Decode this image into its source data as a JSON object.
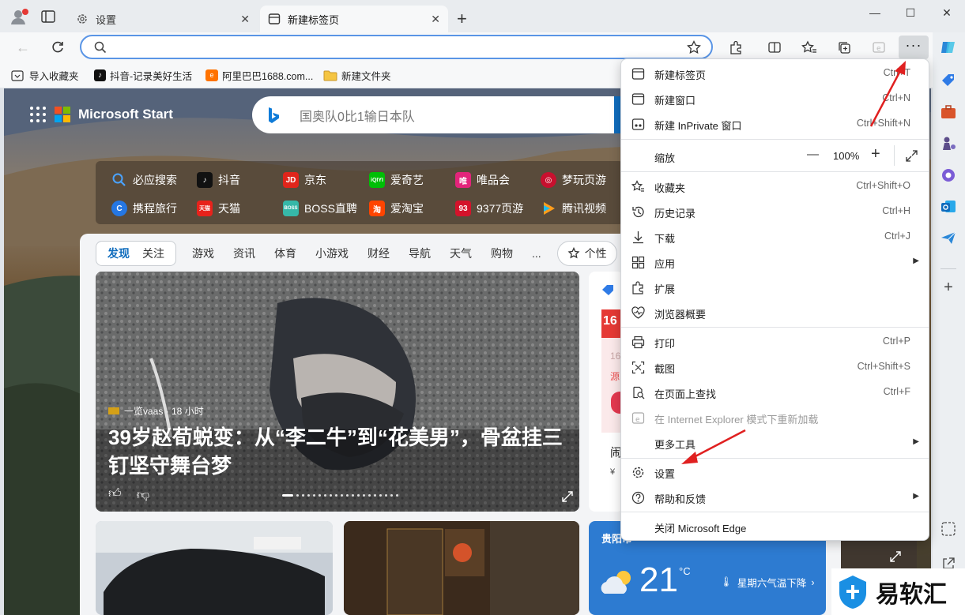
{
  "tabs": [
    {
      "label": "设置"
    },
    {
      "label": "新建标签页"
    }
  ],
  "address": {
    "value": ""
  },
  "favorites": [
    {
      "label": "导入收藏夹"
    },
    {
      "label": "抖音-记录美好生活"
    },
    {
      "label": "阿里巴巴1688.com..."
    },
    {
      "label": "新建文件夹"
    }
  ],
  "ms_start": {
    "label": "Microsoft Start"
  },
  "search": {
    "placeholder": "国奥队0比1输日本队"
  },
  "quick_links": [
    {
      "label": "必应搜索"
    },
    {
      "label": "抖音"
    },
    {
      "label": "京东"
    },
    {
      "label": "爱奇艺"
    },
    {
      "label": "唯品会"
    },
    {
      "label": "梦玩页游"
    },
    {
      "label": "携程旅行"
    },
    {
      "label": "天猫"
    },
    {
      "label": "BOSS直聘"
    },
    {
      "label": "爱淘宝"
    },
    {
      "label": "9377页游"
    },
    {
      "label": "腾讯视频"
    }
  ],
  "feed_tabs": {
    "discover": "发现",
    "follow": "关注",
    "items": [
      "游戏",
      "资讯",
      "体育",
      "小游戏",
      "财经",
      "导航",
      "天气",
      "购物",
      "..."
    ],
    "personalize": "个性"
  },
  "hero": {
    "source": "一览vaas · 18 小时",
    "title": "39岁赵荀蜕变：从“李二牛”到“花美男”，骨盆挂三钉坚守舞台梦"
  },
  "side_card": {
    "num": "16",
    "sub": "16",
    "r": "源",
    "label": "闹",
    "price": "¥"
  },
  "weather": {
    "city": "贵阳市",
    "temp": "21",
    "unit": "°C",
    "note": "星期六气温下降"
  },
  "menu": {
    "items": [
      {
        "label": "新建标签页",
        "shortcut": "Ctrl+T"
      },
      {
        "label": "新建窗口",
        "shortcut": "Ctrl+N"
      },
      {
        "label": "新建 InPrivate 窗口",
        "shortcut": "Ctrl+Shift+N"
      },
      {
        "label": "收藏夹",
        "shortcut": "Ctrl+Shift+O"
      },
      {
        "label": "历史记录",
        "shortcut": "Ctrl+H"
      },
      {
        "label": "下载",
        "shortcut": "Ctrl+J"
      },
      {
        "label": "应用",
        "shortcut": ""
      },
      {
        "label": "扩展",
        "shortcut": ""
      },
      {
        "label": "浏览器概要",
        "shortcut": ""
      },
      {
        "label": "打印",
        "shortcut": "Ctrl+P"
      },
      {
        "label": "截图",
        "shortcut": "Ctrl+Shift+S"
      },
      {
        "label": "在页面上查找",
        "shortcut": "Ctrl+F"
      },
      {
        "label": "在 Internet Explorer 模式下重新加载",
        "shortcut": ""
      },
      {
        "label": "更多工具",
        "shortcut": ""
      },
      {
        "label": "设置",
        "shortcut": ""
      },
      {
        "label": "帮助和反馈",
        "shortcut": ""
      },
      {
        "label": "关闭 Microsoft Edge",
        "shortcut": ""
      }
    ],
    "zoom": {
      "label": "缩放",
      "minus": "—",
      "value": "100%",
      "plus": "+"
    }
  },
  "watermark": {
    "text": "易软汇"
  },
  "colors": {
    "accent": "#0f6cbd",
    "arrow": "#e02020",
    "menu_bg": "#ffffff"
  }
}
